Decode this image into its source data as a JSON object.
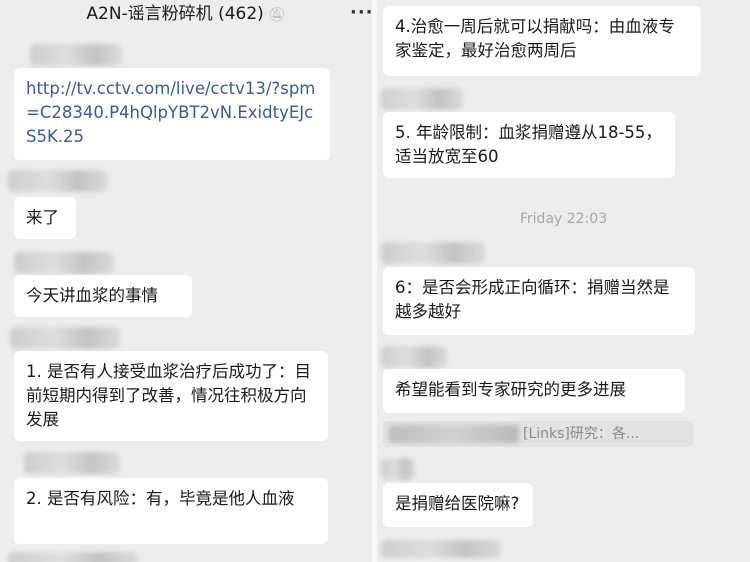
{
  "header": {
    "title": "A2N-谣言粉碎机 (462)",
    "mute_icon": "bell-slash-icon",
    "more_label": "···"
  },
  "left_messages": [
    "http://tv.cctv.com/live/cctv13/?spm=C28340.P4hQlpYBT2vN.ExidtyEJcS5K.25",
    "来了",
    "今天讲血浆的事情",
    "1. 是否有人接受血浆治疗后成功了：目前短期内得到了改善，情况往积极方向发展",
    "2. 是否有风险：有，毕竟是他人血液"
  ],
  "right_messages": [
    "4.治愈一周后就可以捐献吗：由血液专家鉴定，最好治愈两周后",
    "5. 年龄限制：血浆捐赠遵从18-55，适当放宽至60",
    "6：是否会形成正向循环：捐赠当然是越多越好",
    "希望能看到专家研究的更多进展",
    "是捐赠给医院嘛?"
  ],
  "timestamp": "Friday 22:03",
  "quote_text": "[Links]研究：各...",
  "colors": {
    "background": "#ededed",
    "bubble": "#ffffff",
    "link": "#3a5a9a"
  }
}
